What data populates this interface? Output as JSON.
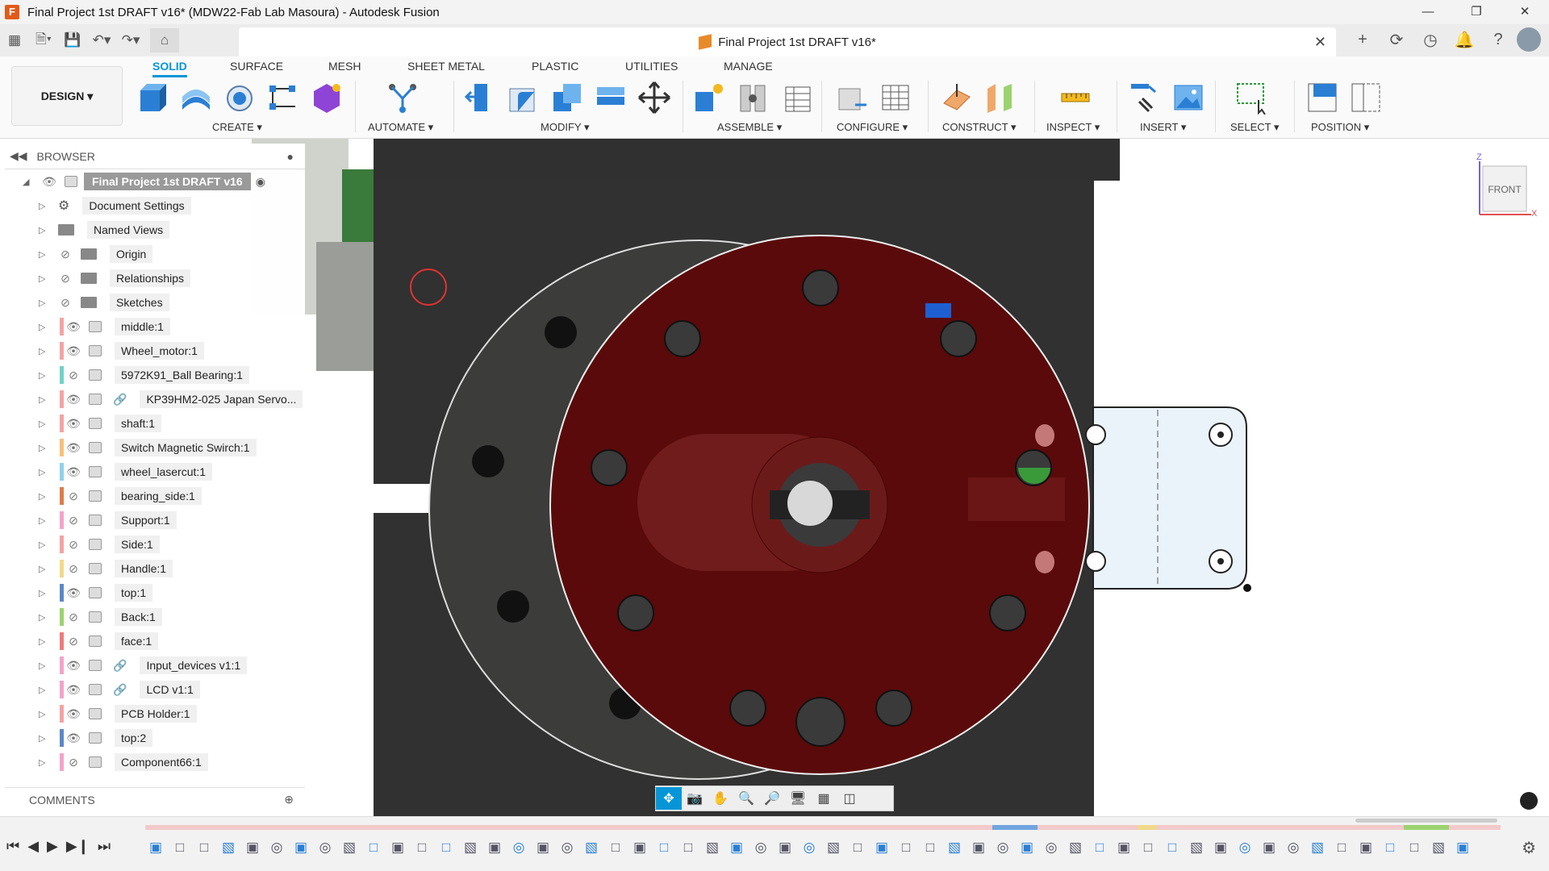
{
  "window": {
    "title": "Final Project 1st DRAFT v16* (MDW22-Fab Lab Masoura) - Autodesk Fusion"
  },
  "doc_tab": {
    "title": "Final Project 1st DRAFT v16*"
  },
  "ribbon": {
    "workspace": "DESIGN",
    "tabs": [
      "SOLID",
      "SURFACE",
      "MESH",
      "SHEET METAL",
      "PLASTIC",
      "UTILITIES",
      "MANAGE"
    ],
    "active_tab": "SOLID",
    "groups": [
      "CREATE",
      "AUTOMATE",
      "MODIFY",
      "ASSEMBLE",
      "CONFIGURE",
      "CONSTRUCT",
      "INSPECT",
      "INSERT",
      "SELECT",
      "POSITION"
    ]
  },
  "browser": {
    "title": "BROWSER",
    "root": "Final Project 1st DRAFT v16",
    "items": [
      {
        "label": "Document Settings",
        "icon": "gear-icon",
        "eye": "none",
        "color": ""
      },
      {
        "label": "Named Views",
        "icon": "folder-icon",
        "eye": "none",
        "color": ""
      },
      {
        "label": "Origin",
        "icon": "folder-icon",
        "eye": "hidden",
        "color": ""
      },
      {
        "label": "Relationships",
        "icon": "folder-icon",
        "eye": "hidden",
        "color": ""
      },
      {
        "label": "Sketches",
        "icon": "folder-icon",
        "eye": "hidden",
        "color": ""
      },
      {
        "label": "middle:1",
        "icon": "component-icon",
        "eye": "visible",
        "color": "#f4a3a3"
      },
      {
        "label": "Wheel_motor:1",
        "icon": "body-icon",
        "eye": "visible",
        "color": "#f4a3a3"
      },
      {
        "label": "5972K91_Ball Bearing:1",
        "icon": "body-icon",
        "eye": "hidden",
        "color": "#6fd3c8"
      },
      {
        "label": "KP39HM2-025 Japan Servo...",
        "icon": "linked-component-icon",
        "eye": "visible",
        "color": "#f4a3a3"
      },
      {
        "label": "shaft:1",
        "icon": "body-icon",
        "eye": "visible",
        "color": "#f4a3a3"
      },
      {
        "label": "Switch Magnetic Swirch:1",
        "icon": "body-icon",
        "eye": "visible",
        "color": "#f7c07a"
      },
      {
        "label": "wheel_lasercut:1",
        "icon": "body-icon",
        "eye": "visible",
        "color": "#8fd1e8"
      },
      {
        "label": "bearing_side:1",
        "icon": "body-icon",
        "eye": "hidden",
        "color": "#e07a4a"
      },
      {
        "label": "Support:1",
        "icon": "body-icon",
        "eye": "hidden",
        "color": "#f4a3c8"
      },
      {
        "label": "Side:1",
        "icon": "body-icon",
        "eye": "hidden",
        "color": "#f4a3a3"
      },
      {
        "label": "Handle:1",
        "icon": "body-icon",
        "eye": "hidden",
        "color": "#f0d98a"
      },
      {
        "label": "top:1",
        "icon": "body-icon",
        "eye": "visible",
        "color": "#5b87c9"
      },
      {
        "label": "Back:1",
        "icon": "body-icon",
        "eye": "hidden",
        "color": "#9bd36f"
      },
      {
        "label": "face:1",
        "icon": "body-icon",
        "eye": "hidden",
        "color": "#f07a7a"
      },
      {
        "label": "Input_devices v1:1",
        "icon": "linked-component-icon",
        "eye": "visible",
        "color": "#f4a3c8"
      },
      {
        "label": "LCD v1:1",
        "icon": "linked-component-icon",
        "eye": "visible",
        "color": "#f4a3c8"
      },
      {
        "label": "PCB Holder:1",
        "icon": "body-icon",
        "eye": "visible",
        "color": "#f4a3a3"
      },
      {
        "label": "top:2",
        "icon": "body-icon",
        "eye": "visible",
        "color": "#5b87c9"
      },
      {
        "label": "Component66:1",
        "icon": "body-icon",
        "eye": "hidden",
        "color": "#f4a3c8"
      }
    ]
  },
  "comments": {
    "title": "COMMENTS"
  },
  "viewcube": {
    "face": "FRONT",
    "axis_z": "Z",
    "axis_x": "X"
  },
  "colors": {
    "accent": "#0696d7",
    "wheel_red": "#5a0a0a",
    "body_dark": "#2f302f"
  }
}
